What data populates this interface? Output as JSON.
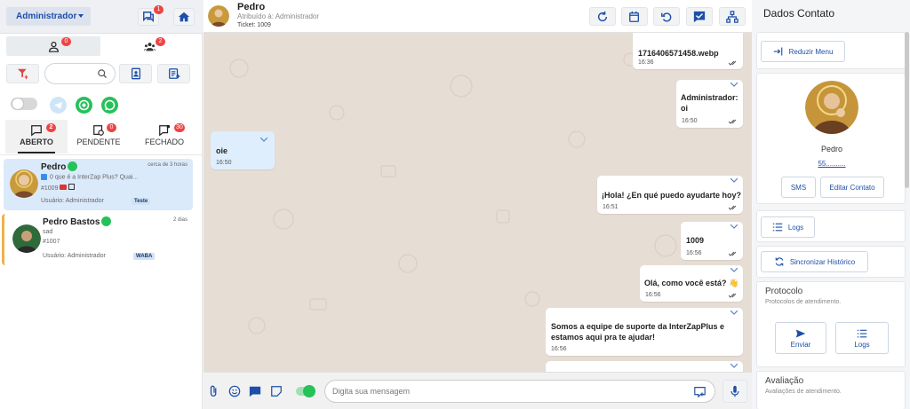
{
  "sidebar": {
    "user_select": "Administrador",
    "messages_badge": "1",
    "tab_my_badge": "0",
    "tab_group_badge": "2",
    "status_tabs": [
      {
        "label": "ABERTO",
        "badge": "2"
      },
      {
        "label": "PENDENTE",
        "badge": "0"
      },
      {
        "label": "FECHADO",
        "badge": "30"
      }
    ],
    "tickets": [
      {
        "name": "Pedro",
        "time": "cerca de 3 horas",
        "preview": "0 que é a InterZap Plus? Quai...",
        "number": "#1009",
        "user": "Usuário: Administrador",
        "tag": "Teste",
        "accent": "#e6f0fb"
      },
      {
        "name": "Pedro Bastos",
        "time": "2 dias",
        "preview": "sad",
        "number": "#1007",
        "user": "Usuário: Administrador",
        "tag": "WABA",
        "accent": "#ffffff"
      }
    ]
  },
  "chat": {
    "contact_name": "Pedro",
    "assigned": "Atribuído à: Administrador",
    "ticket": "Ticket: 1009",
    "messages": [
      {
        "dir": "out",
        "text": "1716406571458.webp",
        "time": "16:36"
      },
      {
        "dir": "out",
        "text": "Administrador:\noi",
        "time": "16:50"
      },
      {
        "dir": "in",
        "text": "oie",
        "time": "16:50"
      },
      {
        "dir": "out",
        "text": "¡Hola! ¿En qué puedo ayudarte hoy?",
        "time": "16:51"
      },
      {
        "dir": "out",
        "text": "1009",
        "time": "16:56"
      },
      {
        "dir": "out",
        "text": "Olá, como você está? 👋",
        "time": "16:56"
      },
      {
        "dir": "out",
        "text": "Somos a equipe de suporte da InterZapPlus e estamos aqui pra te ajudar!",
        "time": "16:56"
      }
    ],
    "composer_placeholder": "Digita sua mensagem"
  },
  "contact": {
    "title": "Dados Contato",
    "collapse_label": "Reduzir Menu",
    "name": "Pedro",
    "phone": "55..........",
    "sms_label": "SMS",
    "edit_label": "Editar Contato",
    "logs_label": "Logs",
    "sync_label": "Sincronizar Histórico",
    "protocol_title": "Protocolo",
    "protocol_sub": "Protocolos de atendimento.",
    "send_label": "Enviar",
    "logs2_label": "Logs",
    "rating_title": "Avaliação",
    "rating_sub": "Avaliações de atendimento."
  },
  "colors": {
    "accent": "#1e4fa8",
    "whatsapp": "#26c15a",
    "badge": "#e44444",
    "chat_bg": "#e6ddd4"
  }
}
